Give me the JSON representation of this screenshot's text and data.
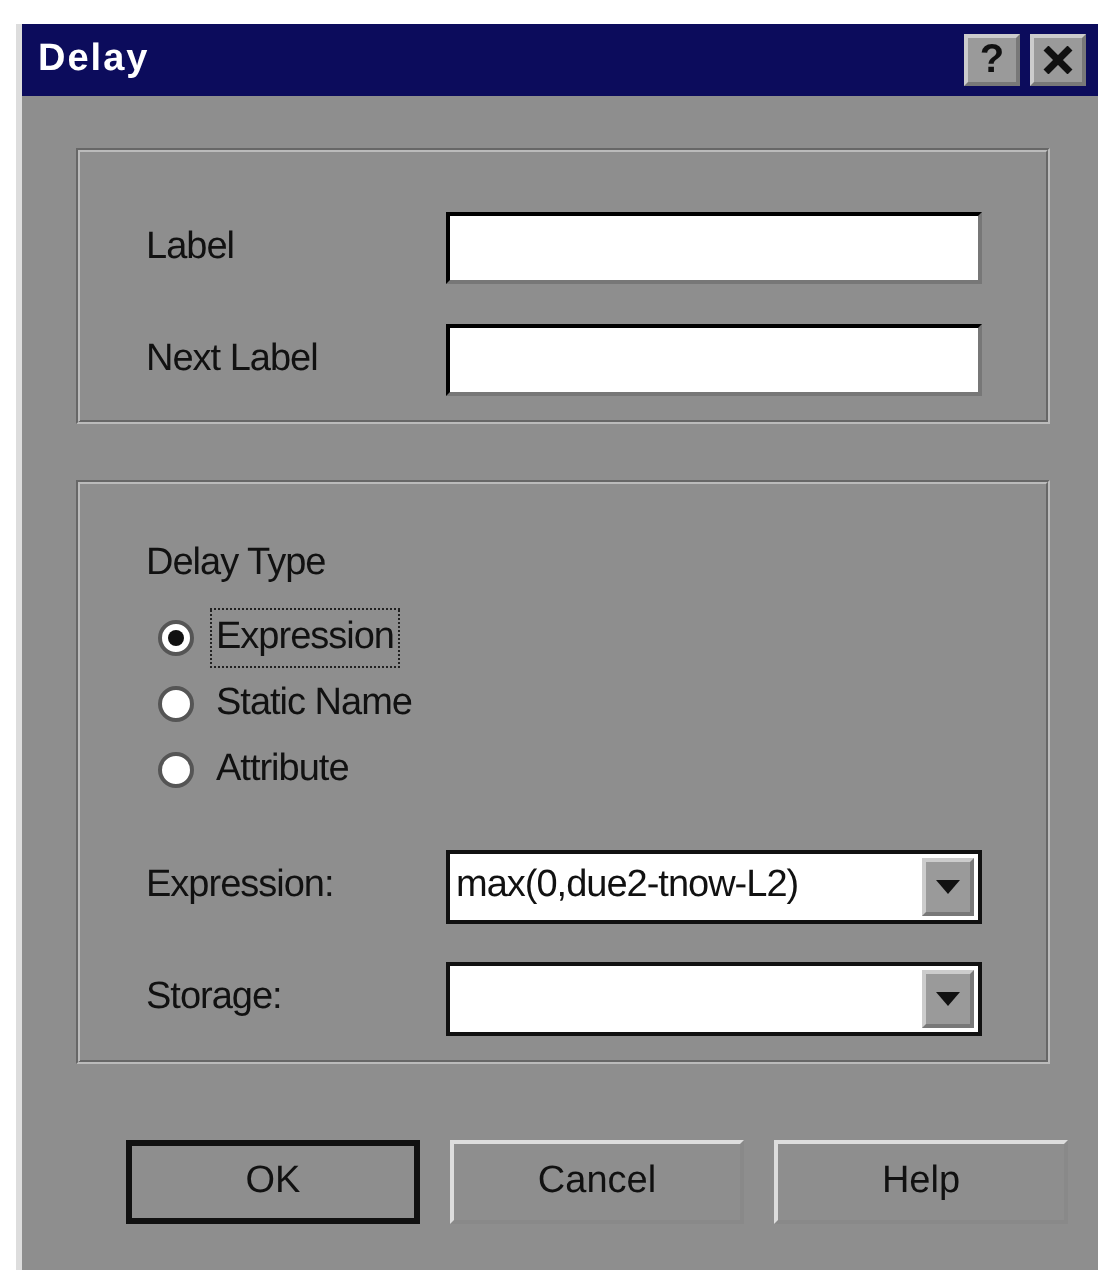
{
  "window": {
    "title": "Delay",
    "help_button": "?"
  },
  "labels_group": {
    "fields": [
      {
        "label": "Label"
      },
      {
        "label": "Next Label"
      }
    ]
  },
  "delay_group": {
    "title": "Delay Type",
    "options": [
      {
        "label": "Expression",
        "selected": true
      },
      {
        "label": "Static Name",
        "selected": false
      },
      {
        "label": "Attribute",
        "selected": false
      }
    ],
    "combos": [
      {
        "label": "Expression:",
        "value": "max(0,due2-tnow-L2)"
      },
      {
        "label": "Storage:"
      }
    ]
  },
  "buttons": [
    {
      "label": "OK",
      "default": true
    },
    {
      "label": "Cancel",
      "default": false
    },
    {
      "label": "Help",
      "default": false
    }
  ]
}
